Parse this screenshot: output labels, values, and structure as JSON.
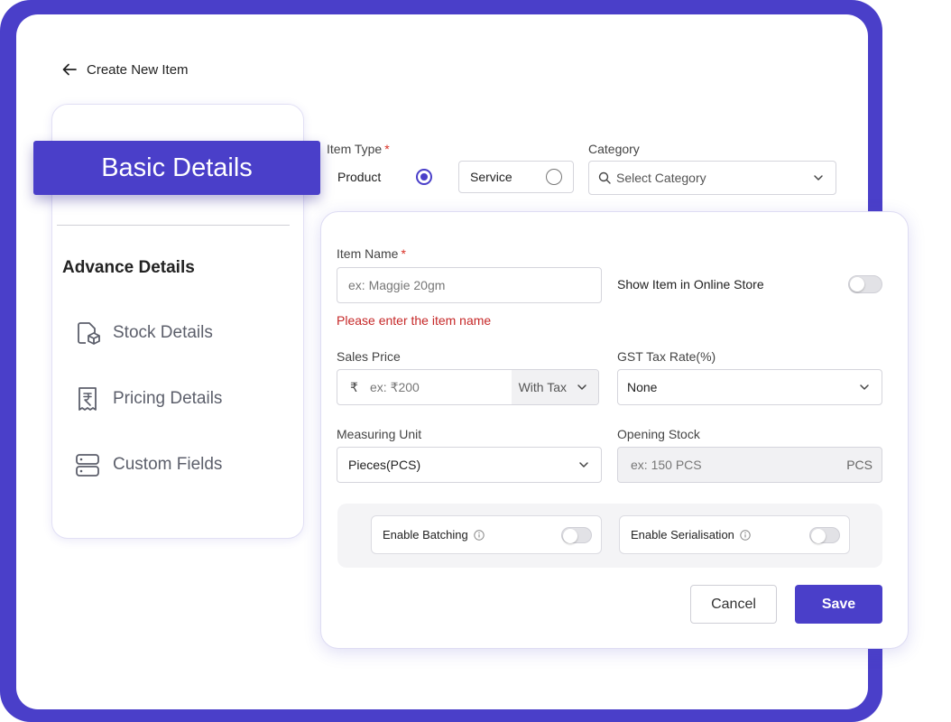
{
  "header": {
    "title": "Create New Item"
  },
  "sidebar": {
    "active_tab": "Basic Details",
    "section_title": "Advance Details",
    "items": [
      {
        "label": "Stock Details",
        "icon": "stock-box-icon"
      },
      {
        "label": "Pricing Details",
        "icon": "rupee-receipt-icon"
      },
      {
        "label": "Custom Fields",
        "icon": "server-stack-icon"
      }
    ]
  },
  "item_type": {
    "label": "Item Type",
    "required": "*",
    "options": [
      "Product",
      "Service"
    ],
    "selected": "Product"
  },
  "category": {
    "label": "Category",
    "placeholder": "Select Category"
  },
  "form": {
    "item_name": {
      "label": "Item Name",
      "required": "*",
      "placeholder": "ex: Maggie 20gm",
      "error": "Please enter the item name"
    },
    "online_store": {
      "label": "Show Item in Online Store",
      "enabled": false
    },
    "sales_price": {
      "label": "Sales Price",
      "currency": "₹",
      "placeholder": "ex: ₹200",
      "tax_mode": "With Tax"
    },
    "gst": {
      "label": "GST Tax Rate(%)",
      "value": "None"
    },
    "measuring_unit": {
      "label": "Measuring Unit",
      "value": "Pieces(PCS)"
    },
    "opening_stock": {
      "label": "Opening Stock",
      "placeholder": "ex: 150 PCS",
      "unit": "PCS"
    },
    "batching": {
      "label": "Enable Batching",
      "enabled": false
    },
    "serialisation": {
      "label": "Enable Serialisation",
      "enabled": false
    }
  },
  "actions": {
    "cancel": "Cancel",
    "save": "Save"
  },
  "colors": {
    "accent": "#4a3fc9",
    "error": "#c62828"
  }
}
